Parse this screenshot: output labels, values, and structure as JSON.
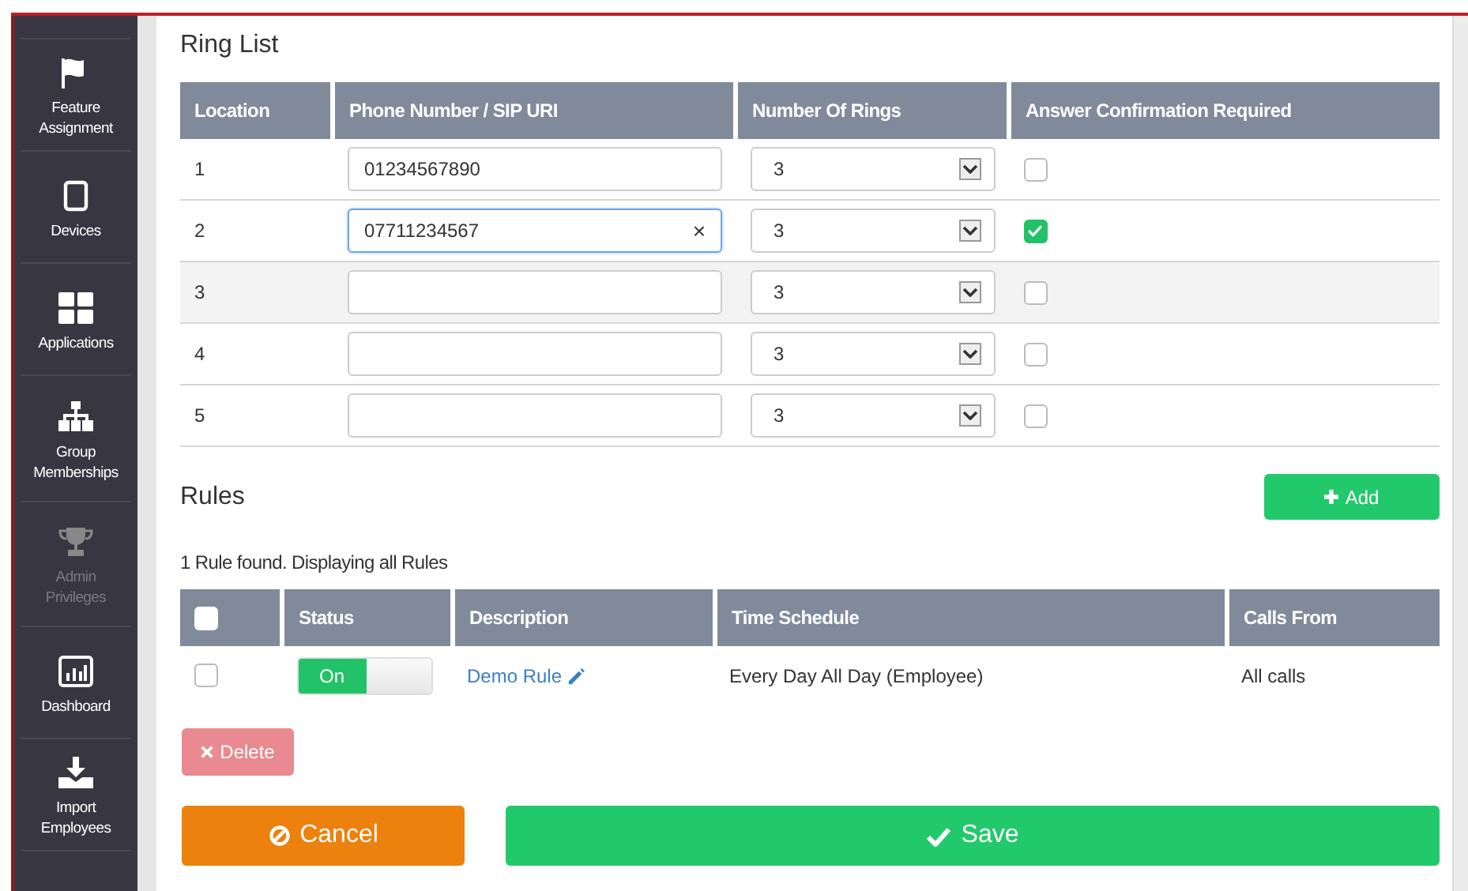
{
  "sidebar": {
    "items": [
      {
        "label": "Feature Assignment",
        "kind": "flag",
        "disabled": false
      },
      {
        "label": "Devices",
        "kind": "tablet",
        "disabled": false
      },
      {
        "label": "Applications",
        "kind": "grid",
        "disabled": false
      },
      {
        "label": "Group Memberships",
        "kind": "sitemap",
        "disabled": false
      },
      {
        "label": "Admin Privileges",
        "kind": "trophy",
        "disabled": true
      },
      {
        "label": "Dashboard",
        "kind": "chart",
        "disabled": false
      },
      {
        "label": "Import Employees",
        "kind": "download",
        "disabled": false
      }
    ]
  },
  "ring_list": {
    "title": "Ring List",
    "columns": [
      "Location",
      "Phone Number / SIP URI",
      "Number Of Rings",
      "Answer Confirmation Required"
    ],
    "rows": [
      {
        "location": "1",
        "phone": "01234567890",
        "focused": false,
        "rings": "3",
        "confirmation": false
      },
      {
        "location": "2",
        "phone": "07711234567",
        "focused": true,
        "clear": "×",
        "rings": "3",
        "confirmation": true
      },
      {
        "location": "3",
        "focused": false,
        "rings": "3",
        "confirmation": false
      },
      {
        "location": "4",
        "focused": false,
        "rings": "3",
        "confirmation": false
      },
      {
        "location": "5",
        "focused": false,
        "rings": "3",
        "confirmation": false
      }
    ]
  },
  "rules": {
    "title": "Rules",
    "add_button": "Add",
    "summary": "1 Rule found. Displaying all Rules",
    "columns": [
      "Status",
      "Description",
      "Time Schedule",
      "Calls From"
    ],
    "select_all": false,
    "rows": [
      {
        "checked": false,
        "status": "On",
        "on": true,
        "description": "Demo Rule",
        "time_schedule": "Every Day All Day (Employee)",
        "calls_from": "All calls"
      }
    ],
    "delete_button": "Delete"
  },
  "buttons": {
    "cancel": "Cancel",
    "save": "Save"
  }
}
